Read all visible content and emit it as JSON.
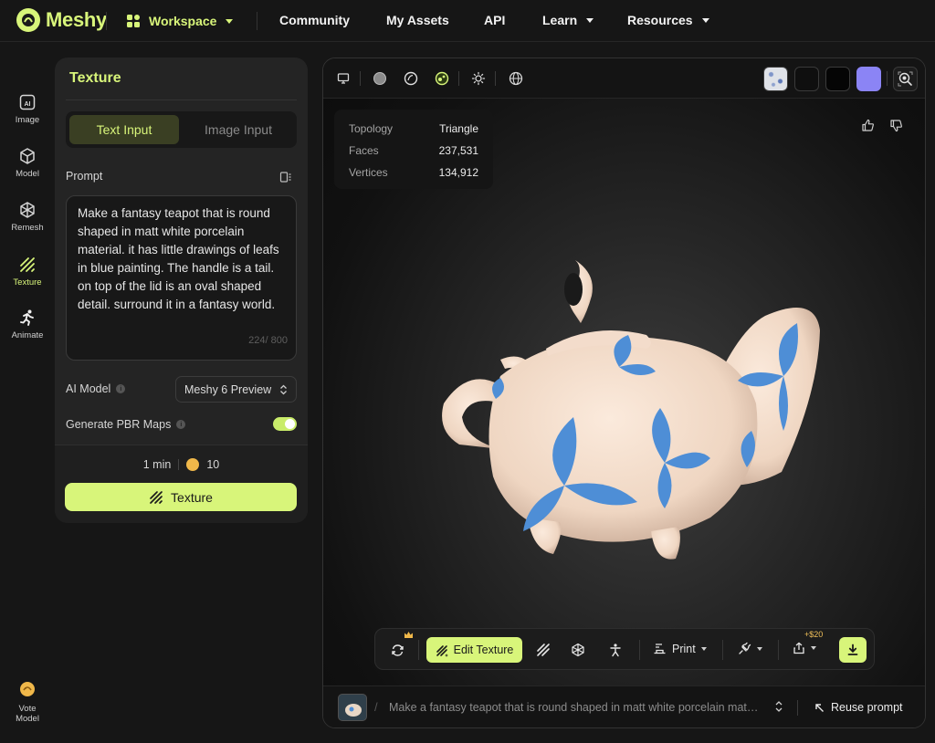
{
  "brand": {
    "name": "Meshy",
    "color": "#d8f57a"
  },
  "nav": {
    "workspace": "Workspace",
    "community": "Community",
    "my_assets": "My Assets",
    "api": "API",
    "learn": "Learn",
    "resources": "Resources"
  },
  "rail": {
    "image": "Image",
    "model": "Model",
    "remesh": "Remesh",
    "texture": "Texture",
    "animate": "Animate",
    "vote_line1": "Vote",
    "vote_line2": "Model"
  },
  "panel": {
    "title": "Texture",
    "tab_text": "Text Input",
    "tab_image": "Image Input",
    "prompt_label": "Prompt",
    "prompt_text": "Make a fantasy teapot that is round shaped in matt white porcelain material. it has little drawings of leafs in blue painting. The handle is a tail. on top of the lid is an oval shaped detail. surround it in a fantasy world.",
    "char_count": "224/ 800",
    "ai_model_label": "AI Model",
    "ai_model_value": "Meshy 6 Preview",
    "pbr_label": "Generate PBR Maps",
    "pbr_enabled": true,
    "time": "1 min",
    "credits": "10",
    "action": "Texture"
  },
  "viewport": {
    "stats": [
      {
        "key": "Topology",
        "value": "Triangle"
      },
      {
        "key": "Faces",
        "value": "237,531"
      },
      {
        "key": "Vertices",
        "value": "134,912"
      }
    ],
    "swatch_colors": [
      "#d9dde3",
      "#0f0f0f",
      "#050505",
      "#8b84f5"
    ],
    "toolbar": {
      "edit_texture": "Edit Texture",
      "print": "Print",
      "price_badge": "+$20"
    },
    "prompt_preview": "Make a fantasy teapot that is round shaped in matt white porcelain material. it has little drawings of leafs in blue painting.",
    "reuse": "Reuse prompt"
  }
}
